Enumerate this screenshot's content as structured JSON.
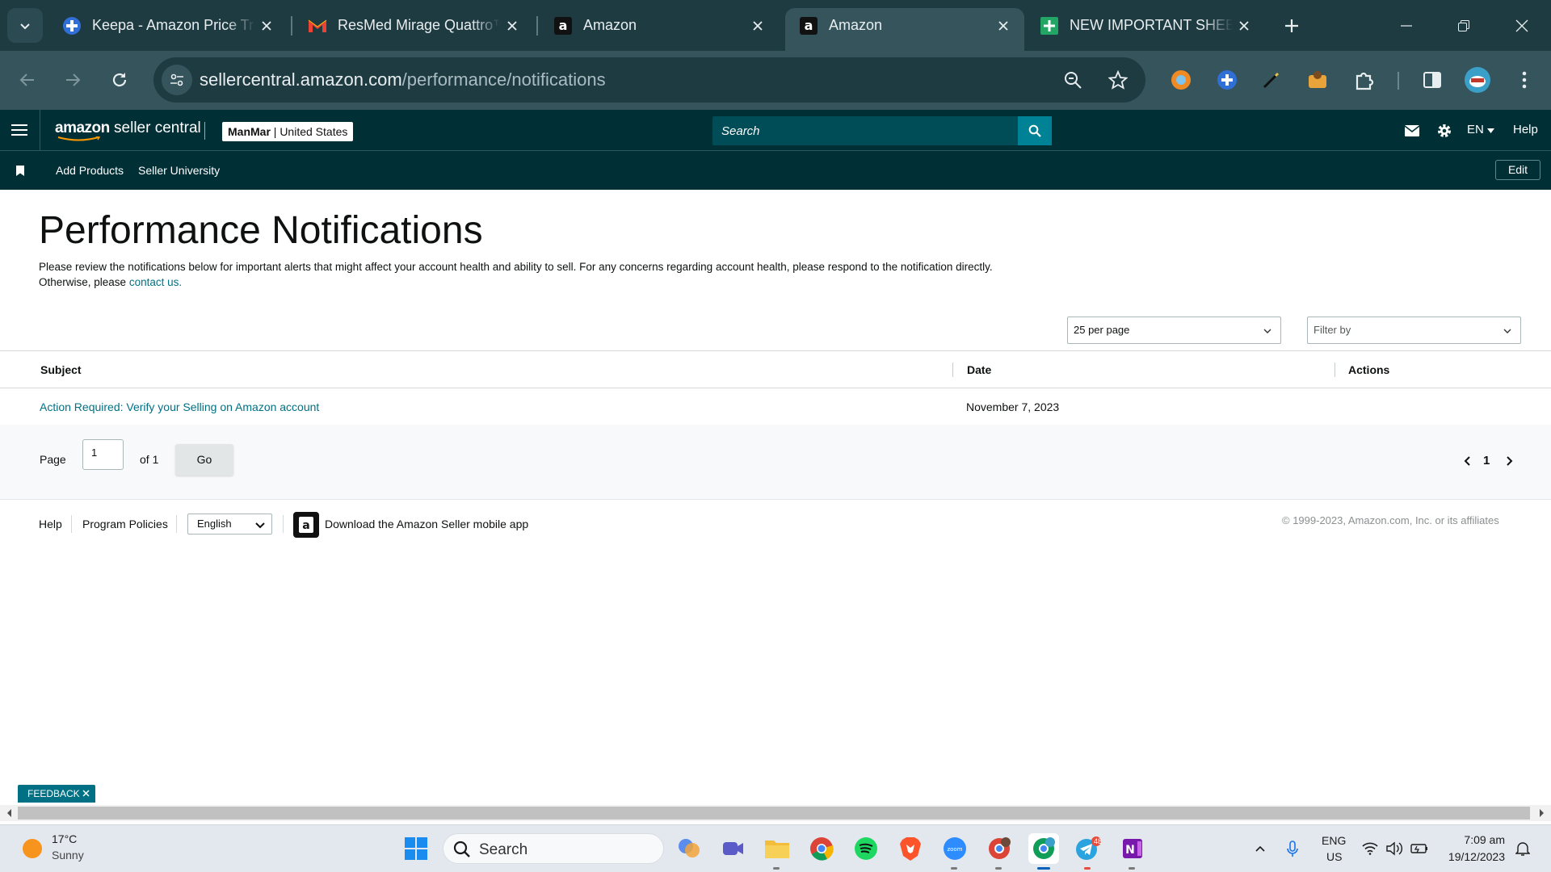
{
  "browser": {
    "tabs": [
      {
        "title": "Keepa - Amazon Price Tracker",
        "icon": "keepa-icon"
      },
      {
        "title": "ResMed Mirage Quattro™ FX",
        "icon": "gmail-icon"
      },
      {
        "title": "Amazon",
        "icon": "amazon-icon"
      },
      {
        "title": "Amazon",
        "icon": "amazon-icon",
        "active": true
      },
      {
        "title": "NEW IMPORTANT SHEET",
        "icon": "sheets-icon"
      }
    ],
    "url_host": "sellercentral.amazon.com",
    "url_path": "/performance/notifications"
  },
  "header": {
    "logo_text": "amazon",
    "logo_sub": " seller central",
    "store_name": "ManMar",
    "store_region": " | United States",
    "search_placeholder": "Search",
    "language": "EN",
    "help": "Help"
  },
  "nav": {
    "links": [
      "Add Products",
      "Seller University"
    ],
    "edit": "Edit"
  },
  "page": {
    "title": "Performance Notifications",
    "description_1": "Please review the notifications below for important alerts that might affect your account health and ability to sell. For any concerns regarding account health, please respond to the notification directly.",
    "description_2": "Otherwise, please ",
    "contact_link": "contact us.",
    "per_page": "25 per page",
    "filter_placeholder": "Filter by"
  },
  "table": {
    "columns": [
      "Subject",
      "Date",
      "Actions"
    ],
    "rows": [
      {
        "subject": "Action Required: Verify your Selling on Amazon account",
        "date": "November 7, 2023",
        "actions": ""
      }
    ]
  },
  "pagination": {
    "page_label": "Page",
    "page_value": "1",
    "of_label": "of 1",
    "go": "Go",
    "current": "1"
  },
  "footer": {
    "help": "Help",
    "program_policies": "Program Policies",
    "language": "English",
    "app_download": "Download the Amazon Seller mobile app",
    "copyright": "© 1999-2023, Amazon.com, Inc. or its affiliates",
    "feedback": "FEEDBACK"
  },
  "taskbar": {
    "weather_temp": "17°C",
    "weather_desc": "Sunny",
    "search": "Search",
    "lang_1": "ENG",
    "lang_2": "US",
    "time": "7:09 am",
    "date": "19/12/2023",
    "telegram_badge": "48"
  }
}
